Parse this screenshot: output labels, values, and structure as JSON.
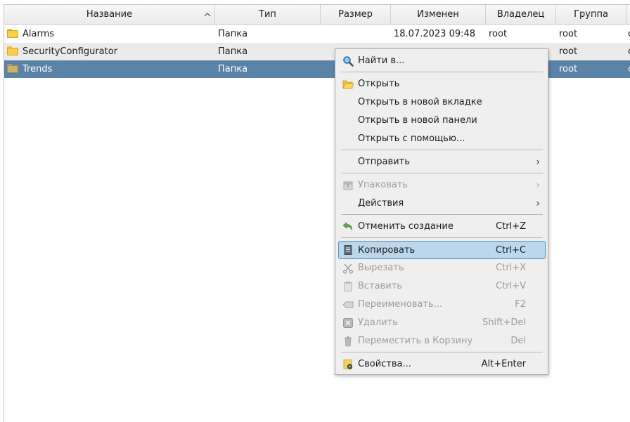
{
  "header": {
    "name": "Название",
    "type": "Тип",
    "size": "Размер",
    "modified": "Изменен",
    "owner": "Владелец",
    "group": "Группа"
  },
  "files": [
    {
      "name": "Alarms",
      "type": "Папка",
      "size": "",
      "modified": "18.07.2023 09:48",
      "owner": "root",
      "group": "root"
    },
    {
      "name": "SecurityConfigurator",
      "type": "Папка",
      "size": "",
      "modified": "",
      "owner": "",
      "group": "root"
    },
    {
      "name": "Trends",
      "type": "Папка",
      "size": "",
      "modified": "",
      "owner": "",
      "group": "root"
    }
  ],
  "menu": {
    "find_in": "Найти в...",
    "open": "Открыть",
    "open_new_tab": "Открыть в новой вкладке",
    "open_new_panel": "Открыть в новой панели",
    "open_with": "Открыть с помощью...",
    "send": "Отправить",
    "pack": "Упаковать",
    "actions": "Действия",
    "undo_create": "Отменить создание",
    "undo_create_shortcut": "Ctrl+Z",
    "copy": "Копировать",
    "copy_shortcut": "Ctrl+C",
    "cut": "Вырезать",
    "cut_shortcut": "Ctrl+X",
    "paste": "Вставить",
    "paste_shortcut": "Ctrl+V",
    "rename": "Переименовать...",
    "rename_shortcut": "F2",
    "delete": "Удалить",
    "delete_shortcut": "Shift+Del",
    "trash": "Переместить в Корзину",
    "trash_shortcut": "Del",
    "properties": "Свойства...",
    "properties_shortcut": "Alt+Enter",
    "submenu_arrow": "›"
  },
  "colors": {
    "selection": "#5b83a7",
    "menu_highlight": "#bcd7ec",
    "menu_highlight_border": "#4f8ec7",
    "folder": "#f7cf4b"
  }
}
